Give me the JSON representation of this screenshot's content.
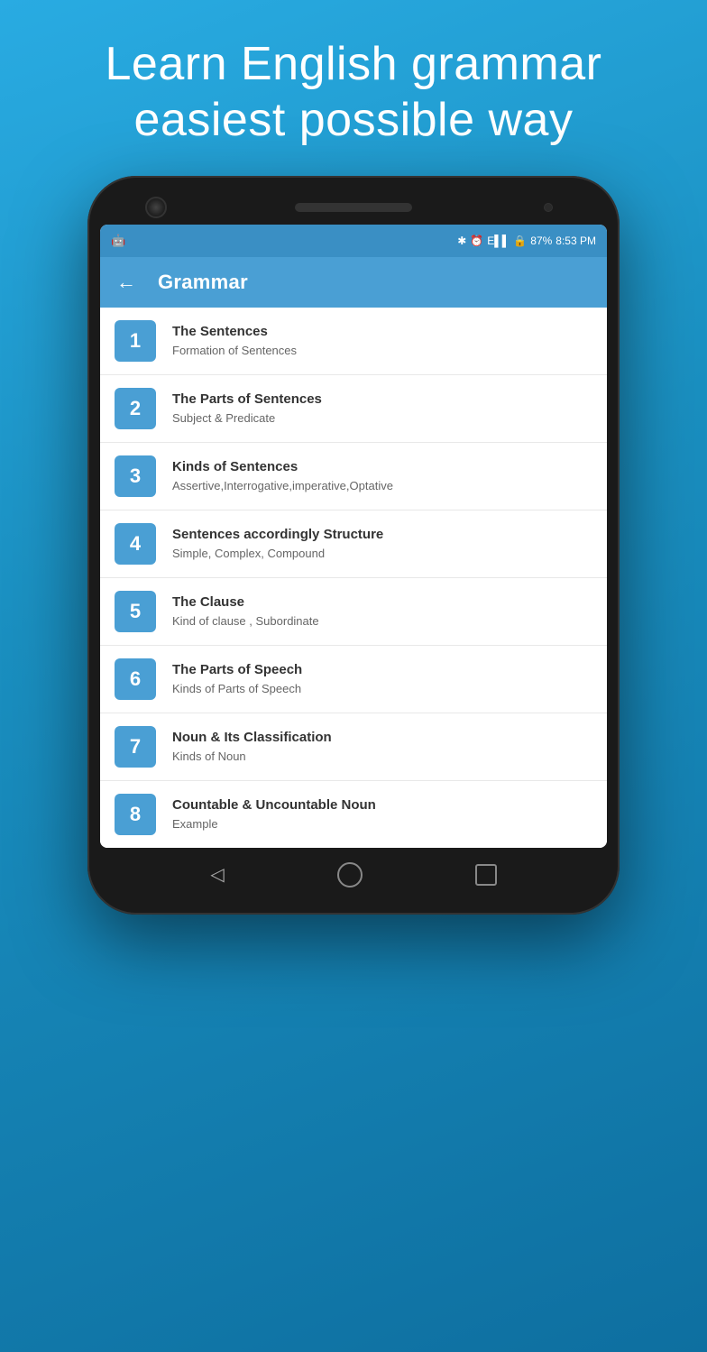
{
  "hero": {
    "line1": "Learn English grammar",
    "line2": "easiest possible way"
  },
  "status_bar": {
    "battery": "87%",
    "time": "8:53 PM"
  },
  "app_bar": {
    "title": "Grammar",
    "back_label": "←"
  },
  "items": [
    {
      "number": "1",
      "title": "The Sentences",
      "subtitle": "Formation of Sentences"
    },
    {
      "number": "2",
      "title": "The Parts of Sentences",
      "subtitle": "Subject & Predicate"
    },
    {
      "number": "3",
      "title": "Kinds of Sentences",
      "subtitle": "Assertive,Interrogative,imperative,Optative"
    },
    {
      "number": "4",
      "title": "Sentences accordingly Structure",
      "subtitle": "Simple, Complex, Compound"
    },
    {
      "number": "5",
      "title": "The Clause",
      "subtitle": "Kind of clause , Subordinate"
    },
    {
      "number": "6",
      "title": "The Parts of Speech",
      "subtitle": "Kinds of Parts of Speech"
    },
    {
      "number": "7",
      "title": "Noun & Its Classification",
      "subtitle": "Kinds of Noun"
    },
    {
      "number": "8",
      "title": "Countable & Uncountable Noun",
      "subtitle": "Example"
    }
  ]
}
